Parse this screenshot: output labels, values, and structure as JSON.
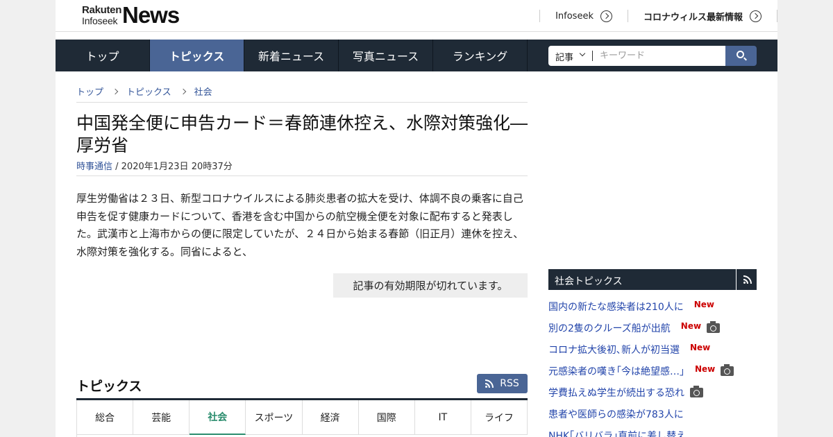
{
  "header": {
    "logo_line1": "Rakuten",
    "logo_line2": "Infoseek",
    "logo_news": "News",
    "links": [
      {
        "label": "Infoseek"
      },
      {
        "label": "コロナウィルス最新情報"
      }
    ]
  },
  "nav": {
    "items": [
      {
        "label": "トップ"
      },
      {
        "label": "トピックス"
      },
      {
        "label": "新着ニュース"
      },
      {
        "label": "写真ニュース"
      },
      {
        "label": "ランキング"
      }
    ],
    "active_index": 1
  },
  "search": {
    "category": "記事",
    "placeholder": "キーワード"
  },
  "breadcrumb": [
    "トップ",
    "トピックス",
    "社会"
  ],
  "article": {
    "title": "中国発全便に申告カード＝春節連休控え、水際対策強化―厚労省",
    "source": "時事通信",
    "date": " / 2020年1月23日 20時37分",
    "body": "厚生労働省は２３日、新型コロナウイルスによる肺炎患者の拡大を受け、体調不良の乗客に自己申告を促す健康カードについて、香港を含む中国からの航空機全便を対象に配布すると発表した。武漢市と上海市からの便に限定していたが、２４日から始まる春節（旧正月）連休を控え、水際対策を強化する。同省によると、",
    "expired_notice": "記事の有効期限が切れています。"
  },
  "topics": {
    "heading": "トピックス",
    "rss_label": "RSS",
    "tabs": [
      "総合",
      "芸能",
      "社会",
      "スポーツ",
      "経済",
      "国際",
      "IT",
      "ライフ"
    ],
    "active_tab": 2
  },
  "sidebar": {
    "heading": "社会トピックス",
    "new_label": "New",
    "items": [
      {
        "text": "国内の新たな感染者は210人に",
        "new": true,
        "photo": false
      },
      {
        "text": "別の2隻のクルーズ船が出航",
        "new": true,
        "photo": true
      },
      {
        "text": "コロナ拡大後初､新人が初当選",
        "new": true,
        "photo": false
      },
      {
        "text": "元感染者の嘆き｢今は絶望感…｣",
        "new": true,
        "photo": true
      },
      {
        "text": "学費払えぬ学生が続出する恐れ",
        "new": false,
        "photo": true
      },
      {
        "text": "患者や医師らの感染が783人に",
        "new": false,
        "photo": false
      },
      {
        "text": "NHK｢バリバラ｣直前に差し替え",
        "new": false,
        "photo": false
      }
    ]
  }
}
